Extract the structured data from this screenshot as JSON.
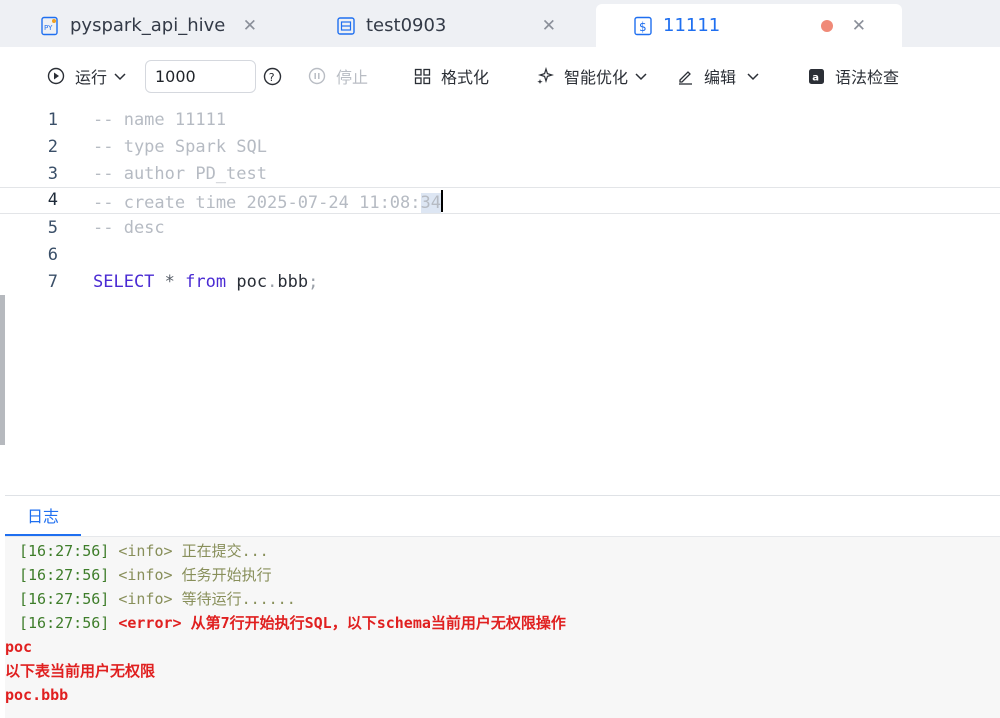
{
  "tabs": [
    {
      "label": "pyspark_api_hive",
      "icon": "python-file-icon",
      "active": false
    },
    {
      "label": "test0903",
      "icon": "workflow-file-icon",
      "active": false
    },
    {
      "label": "11111",
      "icon": "sql-file-icon",
      "active": true,
      "unsaved": true
    }
  ],
  "toolbar": {
    "run_label": "运行",
    "limit_value": "1000",
    "stop_label": "停止",
    "format_label": "格式化",
    "smart_optimize_label": "智能优化",
    "edit_label": "编辑",
    "syntax_check_label": "语法检查"
  },
  "editor": {
    "line_numbers": [
      "1",
      "2",
      "3",
      "4",
      "5",
      "6",
      "7"
    ],
    "current_line": 4,
    "lines": [
      "-- name 11111",
      "-- type Spark SQL",
      "-- author PD_test",
      "-- create time 2025-07-24 11:08:",
      "-- desc",
      "",
      ""
    ],
    "line4_selected": "34",
    "sql": {
      "kw_select": "SELECT",
      "star": "*",
      "kw_from": "from",
      "schema": "poc",
      "dot": ".",
      "table": "bbb",
      "semi": ";"
    }
  },
  "log": {
    "tab_label": "日志",
    "entries": [
      {
        "time": "[16:27:56]",
        "level": "<info>",
        "message": "正在提交..."
      },
      {
        "time": "[16:27:56]",
        "level": "<info>",
        "message": "任务开始执行"
      },
      {
        "time": "[16:27:56]",
        "level": "<info>",
        "message": "等待运行......"
      },
      {
        "time": "[16:27:56]",
        "level": "<error>",
        "message": "从第7行开始执行SQL，以下schema当前用户无权限操作"
      }
    ],
    "error_details": [
      "poc",
      "以下表当前用户无权限",
      "poc.bbb"
    ]
  },
  "colors": {
    "accent": "#1f6ff0",
    "error": "#e02020",
    "timestamp": "#3e7d2a",
    "unsaved_dot": "#f08a78"
  }
}
